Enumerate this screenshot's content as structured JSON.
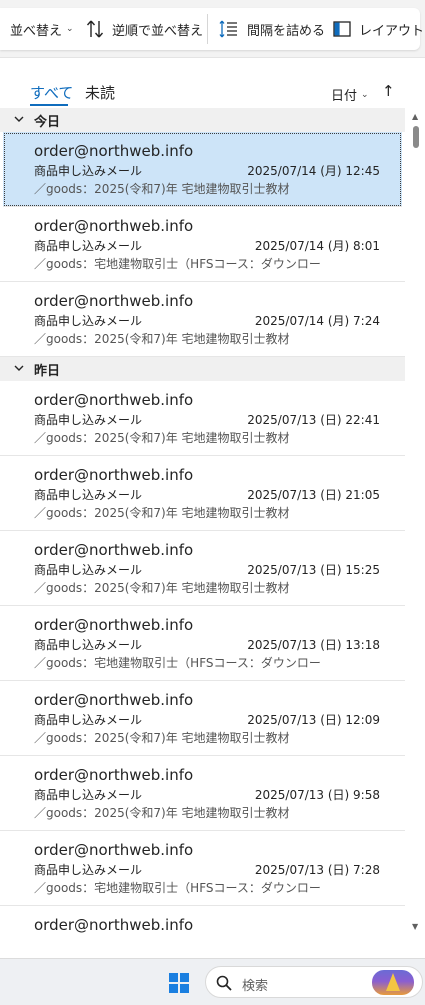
{
  "toolbar": {
    "sort_label": "並べ替え",
    "reverse_label": "逆順で並べ替え",
    "compact_label": "間隔を詰める",
    "layout_label": "レイアウト"
  },
  "tabs": {
    "all": "すべて",
    "unread": "未読",
    "sort_by": "日付"
  },
  "groups": [
    {
      "label": "今日",
      "messages": [
        {
          "from": "order@northweb.info",
          "subject": "商品申し込みメール",
          "date": "2025/07/14 (月) 12:45",
          "preview": "／goods：2025(令和7)年 宅地建物取引士教材",
          "selected": true
        },
        {
          "from": "order@northweb.info",
          "subject": "商品申し込みメール",
          "date": "2025/07/14 (月) 8:01",
          "preview": "／goods：宅地建物取引士（HFSコース：ダウンロー"
        },
        {
          "from": "order@northweb.info",
          "subject": "商品申し込みメール",
          "date": "2025/07/14 (月) 7:24",
          "preview": "／goods：2025(令和7)年 宅地建物取引士教材"
        }
      ]
    },
    {
      "label": "昨日",
      "messages": [
        {
          "from": "order@northweb.info",
          "subject": "商品申し込みメール",
          "date": "2025/07/13 (日) 22:41",
          "preview": "／goods：2025(令和7)年 宅地建物取引士教材"
        },
        {
          "from": "order@northweb.info",
          "subject": "商品申し込みメール",
          "date": "2025/07/13 (日) 21:05",
          "preview": "／goods：2025(令和7)年 宅地建物取引士教材"
        },
        {
          "from": "order@northweb.info",
          "subject": "商品申し込みメール",
          "date": "2025/07/13 (日) 15:25",
          "preview": "／goods：2025(令和7)年 宅地建物取引士教材"
        },
        {
          "from": "order@northweb.info",
          "subject": "商品申し込みメール",
          "date": "2025/07/13 (日) 13:18",
          "preview": "／goods：宅地建物取引士（HFSコース：ダウンロー"
        },
        {
          "from": "order@northweb.info",
          "subject": "商品申し込みメール",
          "date": "2025/07/13 (日) 12:09",
          "preview": "／goods：2025(令和7)年 宅地建物取引士教材"
        },
        {
          "from": "order@northweb.info",
          "subject": "商品申し込みメール",
          "date": "2025/07/13 (日) 9:58",
          "preview": "／goods：2025(令和7)年 宅地建物取引士教材"
        },
        {
          "from": "order@northweb.info",
          "subject": "商品申し込みメール",
          "date": "2025/07/13 (日) 7:28",
          "preview": "／goods：宅地建物取引士（HFSコース：ダウンロー"
        },
        {
          "from": "order@northweb.info",
          "subject": "",
          "date": "",
          "preview": ""
        }
      ]
    }
  ],
  "taskbar": {
    "search_placeholder": "検索"
  },
  "colors": {
    "accent": "#0f6cbd",
    "selected_bg": "#cde4f8",
    "group_bg": "#f0f0f0"
  }
}
